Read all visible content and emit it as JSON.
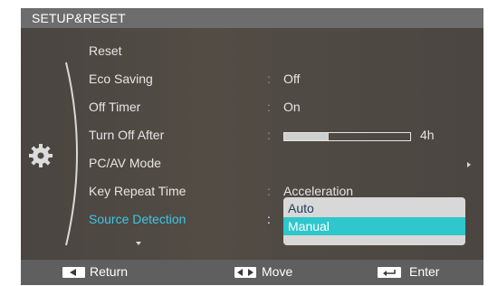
{
  "title": "SETUP&RESET",
  "menu": {
    "items": [
      {
        "label": "Reset",
        "value": ""
      },
      {
        "label": "Eco Saving",
        "value": "Off"
      },
      {
        "label": "Off Timer",
        "value": "On"
      },
      {
        "label": "Turn Off After",
        "value": "4h",
        "level": 0.35
      },
      {
        "label": "PC/AV Mode",
        "value": ""
      },
      {
        "label": "Key Repeat Time",
        "value": "Acceleration"
      },
      {
        "label": "Source Detection",
        "value": ""
      }
    ],
    "separator": ":"
  },
  "dropdown": {
    "options": [
      "Auto",
      "Manual"
    ],
    "selected": "Manual"
  },
  "footer": {
    "return_label": "Return",
    "move_label": "Move",
    "enter_label": "Enter"
  },
  "icons": [
    "gear-icon",
    "return-icon",
    "move-icon",
    "enter-icon",
    "chevron-right-icon",
    "chevron-down-icon"
  ],
  "colors": {
    "active_item": "#3cc7e6",
    "selected_option": "#2ec7cc",
    "panel": "#514c45",
    "header": "#6d6d6d",
    "footer": "#5f5f5f"
  }
}
